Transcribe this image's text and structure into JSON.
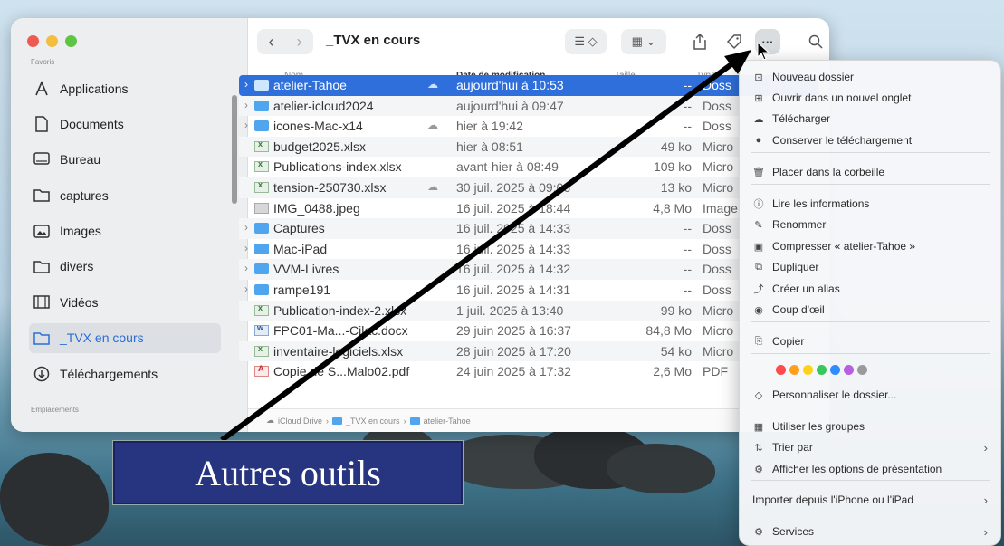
{
  "window": {
    "title": "_TVX en cours"
  },
  "sidebar": {
    "favorites_label": "Favoris",
    "locations_label": "Emplacements",
    "items": [
      {
        "label": "Applications",
        "icon": "applications-icon"
      },
      {
        "label": "Documents",
        "icon": "document-icon"
      },
      {
        "label": "Bureau",
        "icon": "desktop-icon"
      },
      {
        "label": "captures",
        "icon": "folder-icon"
      },
      {
        "label": "Images",
        "icon": "photo-icon"
      },
      {
        "label": "divers",
        "icon": "folder-icon"
      },
      {
        "label": "Vidéos",
        "icon": "film-icon"
      },
      {
        "label": "_TVX en cours",
        "icon": "folder-icon",
        "active": true
      },
      {
        "label": "Téléchargements",
        "icon": "download-icon"
      }
    ]
  },
  "toolbar": {
    "back": "‹",
    "forward": "›",
    "view_list": "☰ ◇",
    "group": "▦ ⌄",
    "more": "···"
  },
  "columns": {
    "name": "Nom",
    "date": "Date de modification",
    "size": "Taille",
    "kind": "Type"
  },
  "files": [
    {
      "name": "atelier-Tahoe",
      "date": "aujourd'hui à 10:53",
      "size": "--",
      "kind": "Doss",
      "type": "folder",
      "disclosure": true,
      "cloud": true,
      "selected": true
    },
    {
      "name": "atelier-icloud2024",
      "date": "aujourd'hui à 09:47",
      "size": "--",
      "kind": "Doss",
      "type": "folder",
      "disclosure": true
    },
    {
      "name": "icones-Mac-x14",
      "date": "hier à 19:42",
      "size": "--",
      "kind": "Doss",
      "type": "folder",
      "disclosure": true,
      "cloud": true
    },
    {
      "name": "budget2025.xlsx",
      "date": "hier à 08:51",
      "size": "49 ko",
      "kind": "Micro",
      "type": "xlsx"
    },
    {
      "name": "Publications-index.xlsx",
      "date": "avant-hier à 08:49",
      "size": "109 ko",
      "kind": "Micro",
      "type": "xlsx"
    },
    {
      "name": "tension-250730.xlsx",
      "date": "30 juil. 2025 à 09:06",
      "size": "13 ko",
      "kind": "Micro",
      "type": "xlsx",
      "cloud": true
    },
    {
      "name": "IMG_0488.jpeg",
      "date": "16 juil. 2025 à 18:44",
      "size": "4,8 Mo",
      "kind": "Image",
      "type": "img"
    },
    {
      "name": "Captures",
      "date": "16 juil. 2025 à 14:33",
      "size": "--",
      "kind": "Doss",
      "type": "folder",
      "disclosure": true
    },
    {
      "name": "Mac-iPad",
      "date": "16 juil. 2025 à 14:33",
      "size": "--",
      "kind": "Doss",
      "type": "folder",
      "disclosure": true
    },
    {
      "name": "VVM-Livres",
      "date": "16 juil. 2025 à 14:32",
      "size": "--",
      "kind": "Doss",
      "type": "folder",
      "disclosure": true
    },
    {
      "name": "rampe191",
      "date": "16 juil. 2025 à 14:31",
      "size": "--",
      "kind": "Doss",
      "type": "folder",
      "disclosure": true
    },
    {
      "name": "Publication-index-2.xlsx",
      "date": "1 juil. 2025 à 13:40",
      "size": "99 ko",
      "kind": "Micro",
      "type": "xlsx"
    },
    {
      "name": "FPC01-Ma...-Cilac.docx",
      "date": "29 juin 2025 à 16:37",
      "size": "84,8 Mo",
      "kind": "Micro",
      "type": "docx"
    },
    {
      "name": "inventaire-logiciels.xlsx",
      "date": "28 juin 2025 à 17:20",
      "size": "54 ko",
      "kind": "Micro",
      "type": "xlsx"
    },
    {
      "name": "Copie de S...Malo02.pdf",
      "date": "24 juin 2025 à 17:32",
      "size": "2,6 Mo",
      "kind": "PDF",
      "type": "pdf"
    }
  ],
  "pathbar": [
    "iCloud Drive",
    "_TVX en cours",
    "atelier-Tahoe"
  ],
  "menu": {
    "items": [
      {
        "label": "Nouveau dossier",
        "icon": "new-folder-icon",
        "glyph": "⊡"
      },
      {
        "label": "Ouvrir dans un nouvel onglet",
        "icon": "new-tab-icon",
        "glyph": "⊞"
      },
      {
        "label": "Télécharger",
        "icon": "cloud-download-icon",
        "glyph": "☁"
      },
      {
        "label": "Conserver le téléchargement",
        "icon": "keep-download-icon",
        "glyph": "●"
      },
      {
        "label": "Placer dans la corbeille",
        "icon": "trash-icon",
        "glyph": "🗑"
      },
      {
        "label": "Lire les informations",
        "icon": "info-icon",
        "glyph": "ⓘ"
      },
      {
        "label": "Renommer",
        "icon": "rename-icon",
        "glyph": "✎"
      },
      {
        "label": "Compresser « atelier-Tahoe »",
        "icon": "compress-icon",
        "glyph": "▣"
      },
      {
        "label": "Dupliquer",
        "icon": "duplicate-icon",
        "glyph": "⧉"
      },
      {
        "label": "Créer un alias",
        "icon": "alias-icon",
        "glyph": "⤴"
      },
      {
        "label": "Coup d'œil",
        "icon": "quicklook-icon",
        "glyph": "◉"
      },
      {
        "label": "Copier",
        "icon": "copy-icon",
        "glyph": "⎘"
      },
      {
        "label": "Personnaliser le dossier...",
        "icon": "tag-icon",
        "glyph": "◇"
      },
      {
        "label": "Utiliser les groupes",
        "icon": "groups-icon",
        "glyph": "▦"
      },
      {
        "label": "Trier par",
        "icon": "sort-icon",
        "glyph": "⇅",
        "submenu": true
      },
      {
        "label": "Afficher les options de présentation",
        "icon": "view-options-icon",
        "glyph": "⚙"
      },
      {
        "label": "Importer depuis l'iPhone ou l'iPad",
        "submenu": true
      },
      {
        "label": "Services",
        "icon": "services-icon",
        "glyph": "⚙",
        "submenu": true
      }
    ],
    "tag_colors": [
      "#ff4b4b",
      "#ff9f1a",
      "#ffd21a",
      "#38c75a",
      "#2f8cff",
      "#b85ee0",
      "#9a9a9a"
    ]
  },
  "annotation": {
    "label": "Autres outils"
  }
}
